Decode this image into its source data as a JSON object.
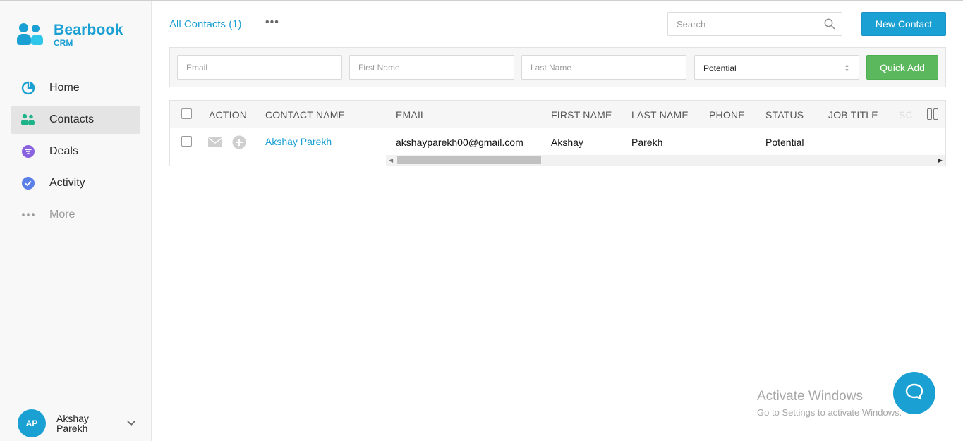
{
  "brand": {
    "name": "Bearbook",
    "sub": "CRM",
    "color": "#1aa0d2"
  },
  "nav": [
    {
      "label": "Home",
      "icon": "pie-chart-icon",
      "active": false
    },
    {
      "label": "Contacts",
      "icon": "people-icon",
      "active": true
    },
    {
      "label": "Deals",
      "icon": "funnel-icon",
      "active": false
    },
    {
      "label": "Activity",
      "icon": "check-circle-icon",
      "active": false
    },
    {
      "label": "More",
      "icon": "more-dots-icon",
      "active": false
    }
  ],
  "user": {
    "initials": "AP",
    "name": "Akshay Parekh"
  },
  "header": {
    "title": "All Contacts (1)",
    "search_placeholder": "Search",
    "new_contact_label": "New Contact"
  },
  "quick_add": {
    "email_placeholder": "Email",
    "first_name_placeholder": "First Name",
    "last_name_placeholder": "Last Name",
    "status_value": "Potential",
    "button_label": "Quick Add"
  },
  "table": {
    "columns": [
      "ACTION",
      "CONTACT NAME",
      "EMAIL",
      "FIRST NAME",
      "LAST NAME",
      "PHONE",
      "STATUS",
      "JOB TITLE",
      "SC"
    ],
    "rows": [
      {
        "contact_name": "Akshay Parekh",
        "email": "akshayparekh00@gmail.com",
        "first_name": "Akshay",
        "last_name": "Parekh",
        "phone": "",
        "status": "Potential",
        "job_title": ""
      }
    ]
  },
  "watermark": {
    "line1": "Activate Windows",
    "line2": "Go to Settings to activate Windows."
  }
}
